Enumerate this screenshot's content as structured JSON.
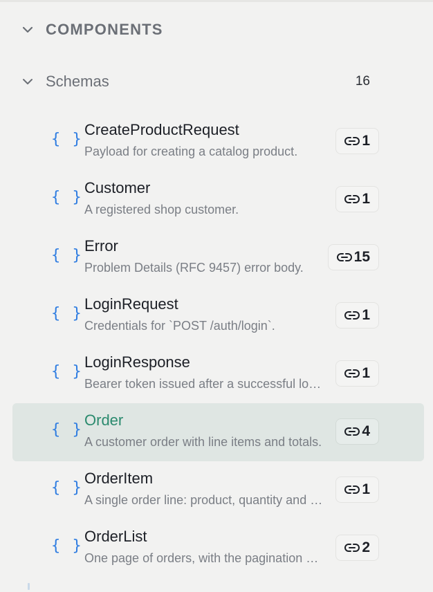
{
  "section": {
    "title": "COMPONENTS",
    "expand_icon": "chevron-down-icon"
  },
  "group": {
    "title": "Schemas",
    "count": "16",
    "expand_icon": "chevron-down-icon"
  },
  "schemas": [
    {
      "name": "CreateProductRequest",
      "description": "Payload for creating a catalog product.",
      "refs": "1",
      "selected": false
    },
    {
      "name": "Customer",
      "description": "A registered shop customer.",
      "refs": "1",
      "selected": false
    },
    {
      "name": "Error",
      "description": "Problem Details (RFC 9457) error body.",
      "refs": "15",
      "selected": false
    },
    {
      "name": "LoginRequest",
      "description": "Credentials for `POST /auth/login`.",
      "refs": "1",
      "selected": false
    },
    {
      "name": "LoginResponse",
      "description": "Bearer token issued after a successful login.",
      "refs": "1",
      "selected": false
    },
    {
      "name": "Order",
      "description": "A customer order with line items and totals.",
      "refs": "4",
      "selected": true
    },
    {
      "name": "OrderItem",
      "description": "A single order line: product, quantity and price.",
      "refs": "1",
      "selected": false
    },
    {
      "name": "OrderList",
      "description": "One page of orders, with the pagination metadata.",
      "refs": "2",
      "selected": false
    }
  ],
  "icons": {
    "schema": "braces-icon",
    "refs": "link-icon"
  },
  "colors": {
    "accent_selected_text": "#2b8a6e",
    "selected_row_bg": "#dfe6e3",
    "braces_icon": "#2f7de1",
    "panel_bg": "#f2f2f1"
  }
}
